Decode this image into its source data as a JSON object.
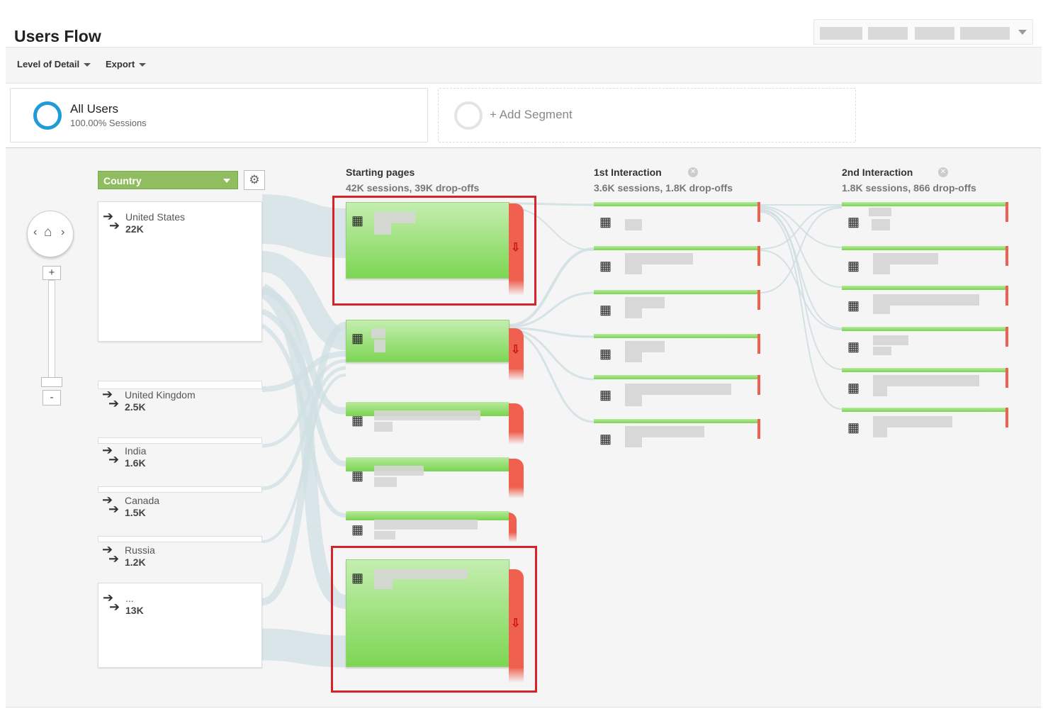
{
  "header": {
    "title": "Users Flow"
  },
  "toolbar": {
    "level_of_detail": "Level of Detail",
    "export": "Export"
  },
  "segments": {
    "all_users": {
      "name": "All Users",
      "sub": "100.00% Sessions"
    },
    "add_segment": "+ Add Segment"
  },
  "nav": {
    "left": "‹",
    "home": "⌂",
    "right": "›",
    "zoom_in": "+",
    "zoom_out": "-"
  },
  "dimension": {
    "label": "Country"
  },
  "countries": [
    {
      "name": "United States",
      "value": "22K"
    },
    {
      "name": "United Kingdom",
      "value": "2.5K"
    },
    {
      "name": "India",
      "value": "1.6K"
    },
    {
      "name": "Canada",
      "value": "1.5K"
    },
    {
      "name": "Russia",
      "value": "1.2K"
    },
    {
      "name": "...",
      "value": "13K"
    }
  ],
  "columns": {
    "starting": {
      "title": "Starting pages",
      "sub": "42K sessions, 39K drop-offs"
    },
    "first": {
      "title": "1st Interaction",
      "sub": "3.6K sessions, 1.8K drop-offs"
    },
    "second": {
      "title": "2nd Interaction",
      "sub": "1.8K sessions, 866 drop-offs"
    }
  },
  "icons": {
    "page": "page-icon",
    "arrows": "redirect-arrows-icon",
    "drop": "drop-off-arrow-icon",
    "gear": "gear-icon",
    "remove": "remove-step-icon"
  },
  "colors": {
    "page_node": "#7dd653",
    "drop_off": "#f0604f",
    "dimension": "#8fbd60",
    "segment_ring": "#1f9bd7",
    "highlight": "#d4242a"
  }
}
